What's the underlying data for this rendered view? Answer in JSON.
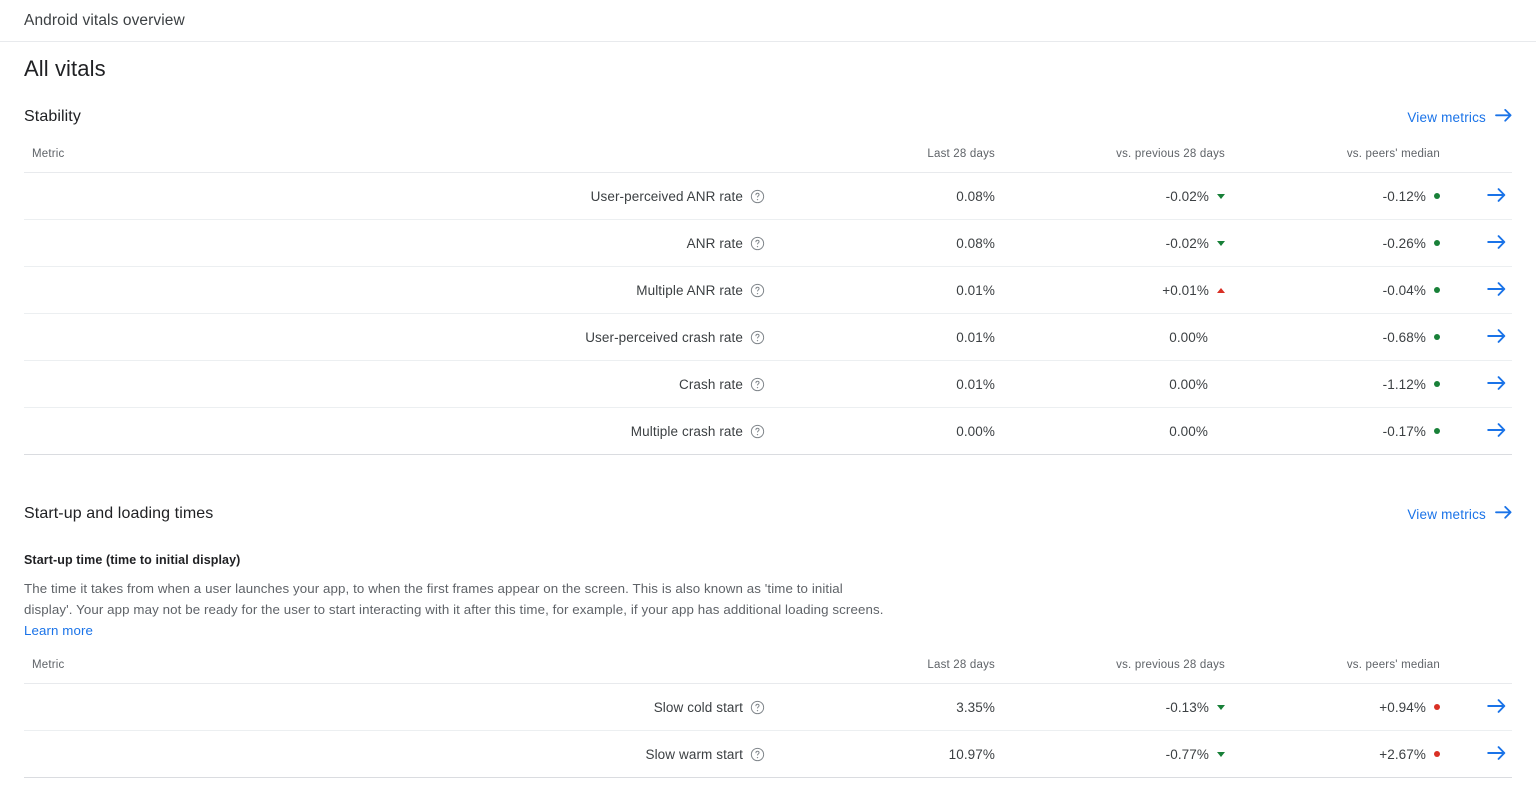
{
  "header": {
    "title": "Android vitals overview"
  },
  "page_title": "All vitals",
  "link_labels": {
    "view_metrics": "View metrics",
    "learn_more": "Learn more"
  },
  "colors": {
    "link_blue": "#1a73e8",
    "good_green": "#188038",
    "bad_red": "#d93025"
  },
  "icons": {
    "help": "help-circle-icon",
    "arrow_right": "arrow-right-icon",
    "trend_down": "triangle-down-icon",
    "trend_up": "triangle-up-icon"
  },
  "sections": [
    {
      "id": "stability",
      "title": "Stability",
      "view_metrics": "View metrics",
      "columns": [
        "Metric",
        "Last 28 days",
        "vs. previous 28 days",
        "vs. peers' median"
      ],
      "rows": [
        {
          "metric": "User-perceived ANR rate",
          "last": "0.08%",
          "prev": "-0.02%",
          "prev_trend": "down",
          "peers": "-0.12%",
          "peers_status": "good"
        },
        {
          "metric": "ANR rate",
          "last": "0.08%",
          "prev": "-0.02%",
          "prev_trend": "down",
          "peers": "-0.26%",
          "peers_status": "good"
        },
        {
          "metric": "Multiple ANR rate",
          "last": "0.01%",
          "prev": "+0.01%",
          "prev_trend": "up",
          "peers": "-0.04%",
          "peers_status": "good"
        },
        {
          "metric": "User-perceived crash rate",
          "last": "0.01%",
          "prev": "0.00%",
          "prev_trend": "none",
          "peers": "-0.68%",
          "peers_status": "good"
        },
        {
          "metric": "Crash rate",
          "last": "0.01%",
          "prev": "0.00%",
          "prev_trend": "none",
          "peers": "-1.12%",
          "peers_status": "good"
        },
        {
          "metric": "Multiple crash rate",
          "last": "0.00%",
          "prev": "0.00%",
          "prev_trend": "none",
          "peers": "-0.17%",
          "peers_status": "good"
        }
      ]
    },
    {
      "id": "startup",
      "title": "Start-up and loading times",
      "view_metrics": "View metrics",
      "sub_title": "Start-up time (time to initial display)",
      "description_before": "The time it takes from when a user launches your app, to when the first frames appear on the screen. This is also known as 'time to initial display'. Your app may not be ready for the user to start interacting with it after this time, for example, if your app has additional loading screens. ",
      "description_link": "Learn more",
      "columns": [
        "Metric",
        "Last 28 days",
        "vs. previous 28 days",
        "vs. peers' median"
      ],
      "rows": [
        {
          "metric": "Slow cold start",
          "last": "3.35%",
          "prev": "-0.13%",
          "prev_trend": "down",
          "peers": "+0.94%",
          "peers_status": "bad"
        },
        {
          "metric": "Slow warm start",
          "last": "10.97%",
          "prev": "-0.77%",
          "prev_trend": "down",
          "peers": "+2.67%",
          "peers_status": "bad"
        }
      ]
    }
  ]
}
